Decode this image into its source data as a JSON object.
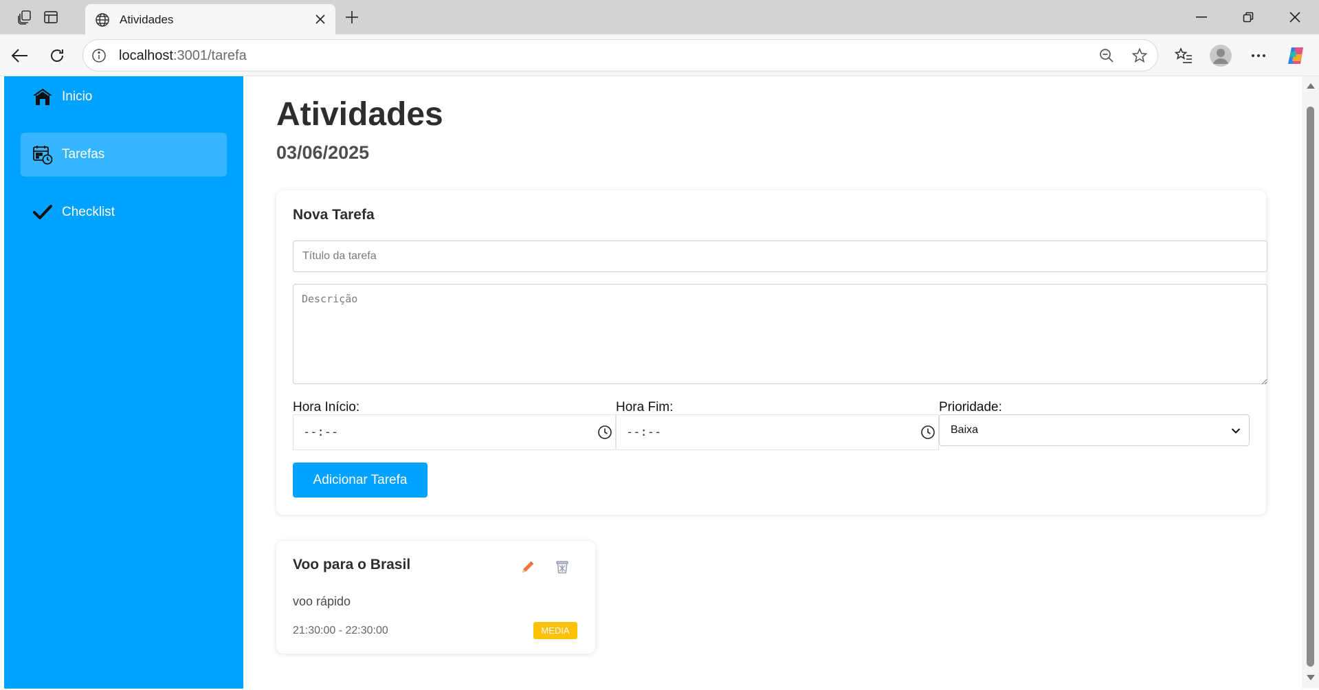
{
  "browser": {
    "tab_title": "Atividades",
    "url_host": "localhost",
    "url_path": ":3001/tarefa"
  },
  "sidebar": {
    "items": [
      {
        "label": "Inicio",
        "icon": "home-icon"
      },
      {
        "label": "Tarefas",
        "icon": "calendar-clock-icon",
        "active": true
      },
      {
        "label": "Checklist",
        "icon": "checkmark-icon"
      }
    ]
  },
  "page": {
    "title": "Atividades",
    "date": "03/06/2025"
  },
  "form": {
    "heading": "Nova Tarefa",
    "title_placeholder": "Título da tarefa",
    "description_placeholder": "Descrição",
    "start_label": "Hora Início:",
    "end_label": "Hora Fim:",
    "priority_label": "Prioridade:",
    "start_value": "--:--",
    "end_value": "--:--",
    "priority_value": "Baixa",
    "submit_label": "Adicionar Tarefa"
  },
  "tasks": [
    {
      "title": "Voo para o Brasil",
      "description": "voo rápido",
      "time": "21:30:00 - 22:30:00",
      "priority": "MEDIA"
    }
  ],
  "colors": {
    "sidebar": "#00a2ff",
    "sidebar_active": "#36b6ff",
    "button": "#00a2ff",
    "badge_media": "#ffc107",
    "edit_icon": "#f0783c",
    "delete_icon": "#9aa0b4"
  }
}
